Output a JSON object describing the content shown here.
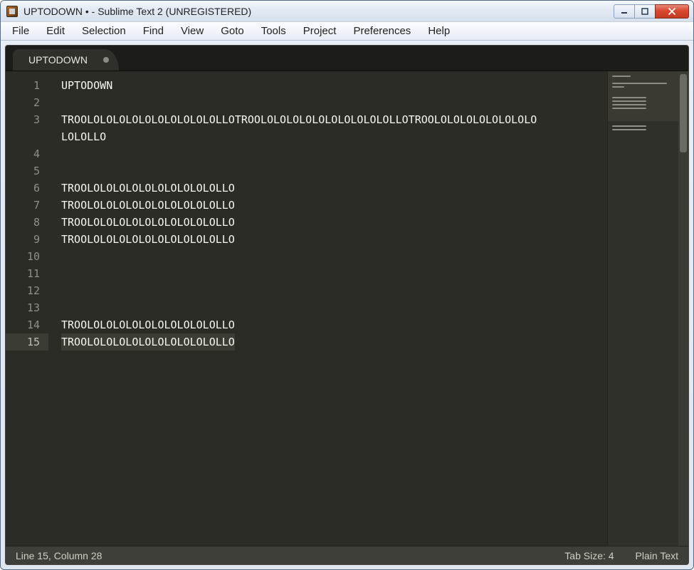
{
  "window_title": "UPTODOWN • - Sublime Text 2 (UNREGISTERED)",
  "menubar": [
    "File",
    "Edit",
    "Selection",
    "Find",
    "View",
    "Goto",
    "Tools",
    "Project",
    "Preferences",
    "Help"
  ],
  "tab": {
    "name": "UPTODOWN",
    "dirty": true
  },
  "editor": {
    "lines": [
      "UPTODOWN",
      "",
      "TROOLOLOLOLOLOLOLOLOLOLOLLOTROOLOLOLOLOLOLOLOLOLOLOLLOTROOLOLOLOLOLOLOLOLOLOLOLLO",
      "",
      "",
      "TROOLOLOLOLOLOLOLOLOLOLOLLO",
      "TROOLOLOLOLOLOLOLOLOLOLOLLO",
      "TROOLOLOLOLOLOLOLOLOLOLOLLO",
      "TROOLOLOLOLOLOLOLOLOLOLOLLO",
      "",
      "",
      "",
      "",
      "TROOLOLOLOLOLOLOLOLOLOLOLLO",
      "TROOLOLOLOLOLOLOLOLOLOLOLLO"
    ],
    "current_line": 15
  },
  "statusbar": {
    "position": "Line 15, Column 28",
    "tab_size": "Tab Size: 4",
    "syntax": "Plain Text"
  }
}
